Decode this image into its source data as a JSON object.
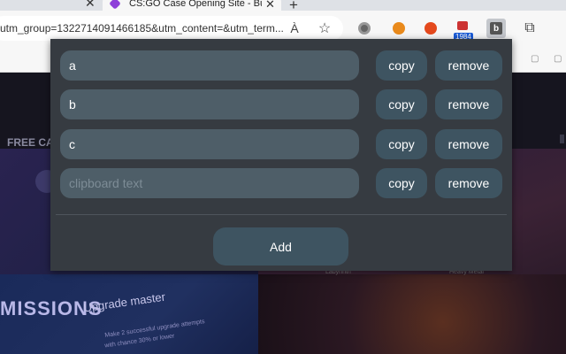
{
  "browser": {
    "tab_title": "CS:GO Case Opening Site - Buy C",
    "close_glyph": "✕",
    "new_tab_glyph": "+",
    "address_text": "utm_group=1322714091466185&utm_content=&utm_term...",
    "read_aloud_label": "À",
    "favorite_glyph": "☆",
    "extension_badge": "1984",
    "extension_b_label": "b",
    "puzzle_glyph": "⧉"
  },
  "website": {
    "free_label": "FREE CA",
    "missions_label": "MISSIONS",
    "upgrade_title": "Upgrade master",
    "upgrade_line1": "Make 2 successful upgrade attempts",
    "upgrade_line2": "with chance 30% or lower",
    "card_label_1": "Labyrinth",
    "card_label_2": "Heavy Metal"
  },
  "popup": {
    "items": [
      {
        "value": "a",
        "placeholder": "clipboard text",
        "copy_label": "copy",
        "remove_label": "remove"
      },
      {
        "value": "b",
        "placeholder": "clipboard text",
        "copy_label": "copy",
        "remove_label": "remove"
      },
      {
        "value": "c",
        "placeholder": "clipboard text",
        "copy_label": "copy",
        "remove_label": "remove"
      },
      {
        "value": "",
        "placeholder": "clipboard text",
        "copy_label": "copy",
        "remove_label": "remove"
      }
    ],
    "add_label": "Add"
  },
  "colors": {
    "popup_bg": "#363b41",
    "input_bg": "#4e5e68",
    "button_bg": "#3e5461",
    "text": "#ffffff",
    "placeholder": "#7d8c96"
  }
}
